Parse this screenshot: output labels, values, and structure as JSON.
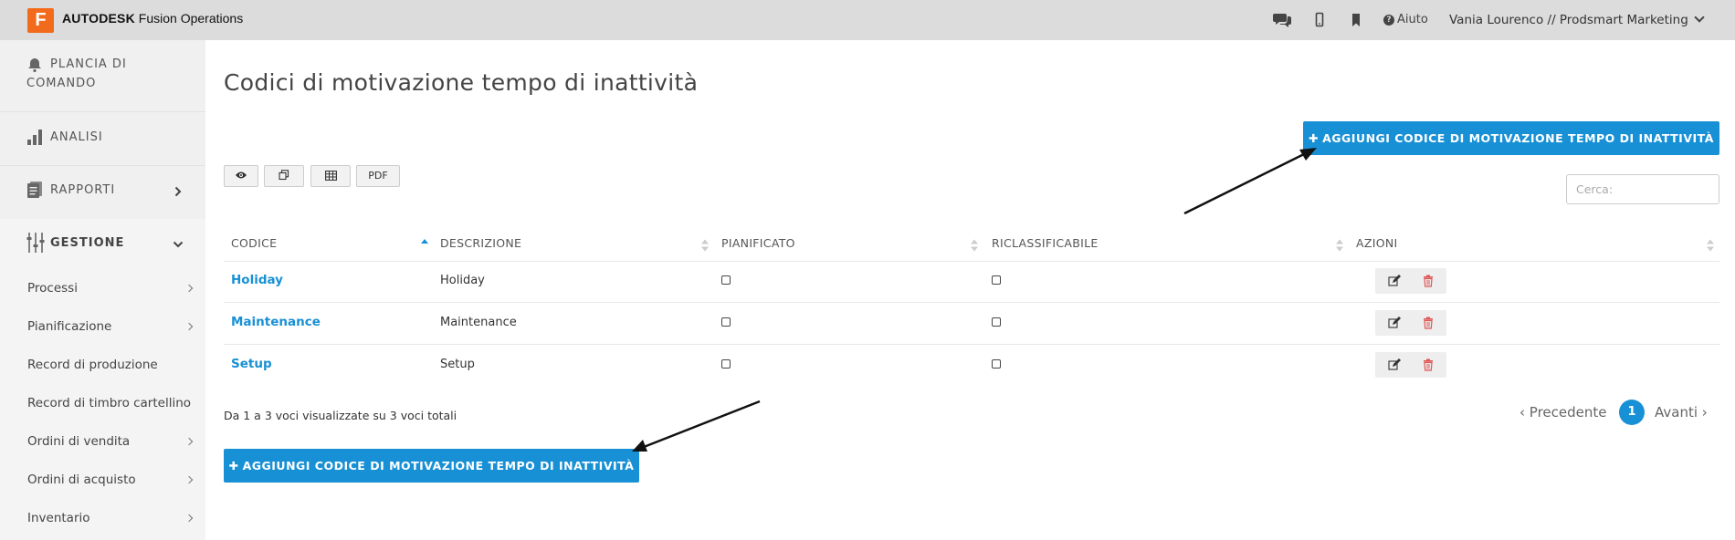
{
  "header": {
    "logo_letter": "F",
    "brand_bold": "AUTODESK",
    "brand_rest": " Fusion Operations",
    "icons": [
      "chat-icon",
      "mobile-icon",
      "bookmark-icon"
    ],
    "help_label": "Aiuto",
    "user_label": "Vania Lourenco // Prodsmart Marketing",
    "bar_color": "#dcdcdc",
    "logo_color": "#f26a1b"
  },
  "sidebar": {
    "main": [
      {
        "label_line1": "PLANCIA DI",
        "label_line2": "COMANDO",
        "icon": "bell-icon"
      },
      {
        "label": "ANALISI",
        "icon": "bar-chart-icon"
      },
      {
        "label": "RAPPORTI",
        "icon": "reports-icon"
      },
      {
        "label": "GESTIONE",
        "icon": "sliders-icon"
      }
    ],
    "sub": [
      {
        "label": "Processi"
      },
      {
        "label": "Pianificazione"
      },
      {
        "label": "Record di produzione"
      },
      {
        "label": "Record di timbro cartellino"
      },
      {
        "label": "Ordini di vendita"
      },
      {
        "label": "Ordini di acquisto"
      },
      {
        "label": "Inventario"
      }
    ]
  },
  "page": {
    "title": "Codici di motivazione tempo di inattività",
    "add_button_label": "AGGIUNGI CODICE DI MOTIVAZIONE TEMPO DI INATTIVITÀ",
    "toolbar": {
      "pdf_label": "PDF"
    },
    "search_placeholder": "Cerca:",
    "accent_color": "#1890d5"
  },
  "table": {
    "columns": [
      "CODICE",
      "DESCRIZIONE",
      "PIANIFICATO",
      "RICLASSIFICABILE",
      "AZIONI"
    ],
    "rows": [
      {
        "code": "Holiday",
        "description": "Holiday",
        "planned": false,
        "reclassifiable": false
      },
      {
        "code": "Maintenance",
        "description": "Maintenance",
        "planned": false,
        "reclassifiable": false
      },
      {
        "code": "Setup",
        "description": "Setup",
        "planned": false,
        "reclassifiable": false
      }
    ],
    "info": "Da 1 a 3 voci visualizzate su 3 voci totali"
  },
  "pagination": {
    "prev_label": "Precedente",
    "current_page": "1",
    "next_label": "Avanti"
  }
}
